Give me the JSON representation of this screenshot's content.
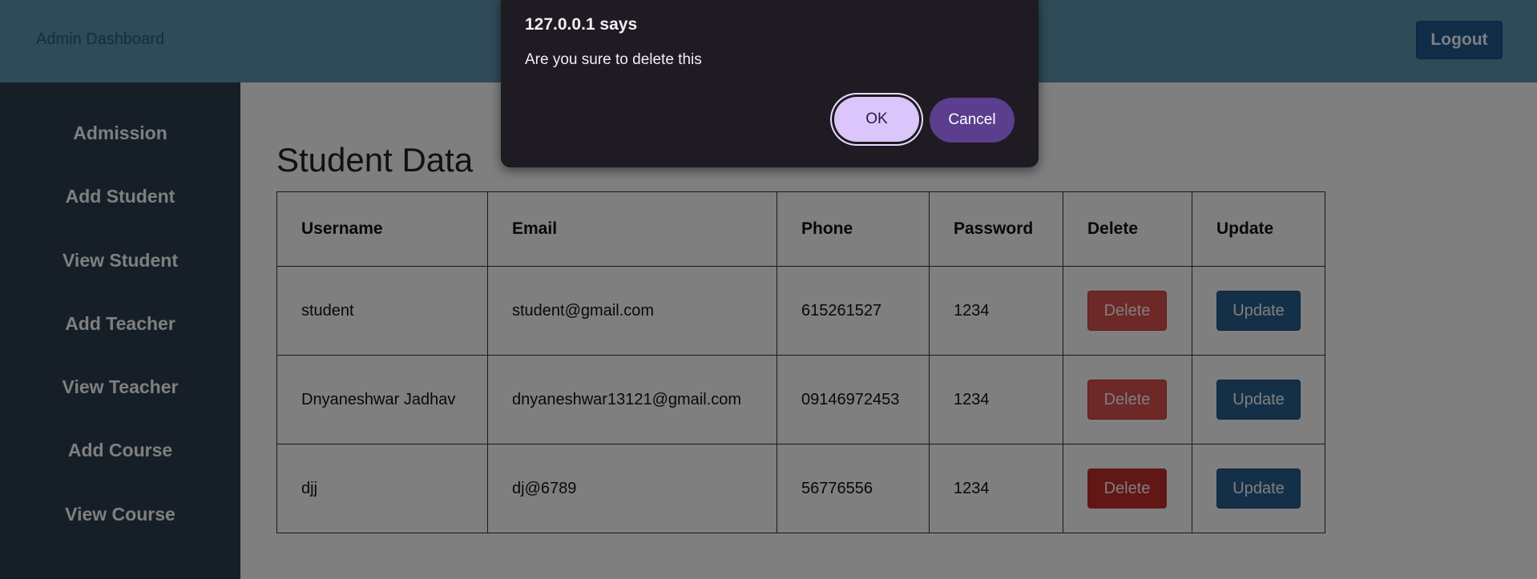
{
  "header": {
    "brand": "Admin Dashboard",
    "logout_label": "Logout"
  },
  "sidebar": {
    "items": [
      {
        "label": "Admission"
      },
      {
        "label": "Add Student"
      },
      {
        "label": "View Student"
      },
      {
        "label": "Add Teacher"
      },
      {
        "label": "View Teacher"
      },
      {
        "label": "Add Course"
      },
      {
        "label": "View Course"
      }
    ]
  },
  "main": {
    "title": "Student Data",
    "table": {
      "headers": [
        "Username",
        "Email",
        "Phone",
        "Password",
        "Delete",
        "Update"
      ],
      "rows": [
        {
          "username": "student",
          "email": "student@gmail.com",
          "phone": "615261527",
          "password": "1234",
          "delete_label": "Delete",
          "update_label": "Update"
        },
        {
          "username": "Dnyaneshwar Jadhav",
          "email": "dnyaneshwar13121@gmail.com",
          "phone": "09146972453",
          "password": "1234",
          "delete_label": "Delete",
          "update_label": "Update"
        },
        {
          "username": "djj",
          "email": "dj@6789",
          "phone": "56776556",
          "password": "1234",
          "delete_label": "Delete",
          "update_label": "Update"
        }
      ]
    }
  },
  "dialog": {
    "title": "127.0.0.1 says",
    "message": "Are you sure to delete this",
    "ok_label": "OK",
    "cancel_label": "Cancel"
  },
  "colors": {
    "header_bg": "#5e97b0",
    "sidebar_bg": "#2d3e50",
    "delete_btn": "#d9534f",
    "update_btn": "#286090",
    "dialog_bg": "#1e1b22",
    "dialog_ok": "#dac6fb",
    "dialog_cancel": "#5b3e8e"
  }
}
